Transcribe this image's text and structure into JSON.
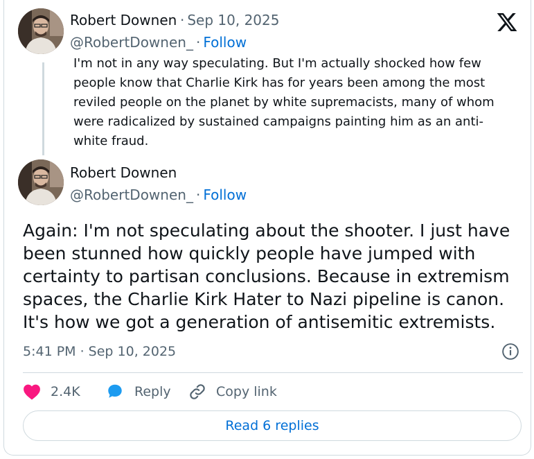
{
  "parent_tweet": {
    "author_name": "Robert Downen",
    "date": "Sep 10, 2025",
    "handle": "@RobertDownen_",
    "follow_label": "Follow",
    "text": "I'm not in any way speculating. But I'm actually shocked how few people know that Charlie Kirk has for years been among the most reviled people on the planet by white supremacists, many of whom were radicalized by sustained campaigns painting him as an anti-white fraud."
  },
  "main_tweet": {
    "author_name": "Robert Downen",
    "handle": "@RobertDownen_",
    "follow_label": "Follow",
    "text": "Again: I'm not speculating about the shooter. I just have been stunned how quickly people have jumped with certainty to partisan conclusions. Because in extremism spaces, the Charlie Kirk Hater to Nazi pipeline is canon. It's how we got a generation of antisemitic extremists.",
    "timestamp": "5:41 PM · Sep 10, 2025"
  },
  "actions": {
    "likes_count": "2.4K",
    "reply_label": "Reply",
    "copy_link_label": "Copy link"
  },
  "read_replies_label": "Read 6 replies",
  "colors": {
    "link_blue": "#006fd6",
    "like_pink": "#f91880",
    "reply_blue": "#1d9bf0",
    "secondary_text": "#536471",
    "border": "#cfd9de"
  },
  "icons": {
    "brand": "x-logo-icon",
    "info": "info-icon",
    "like": "heart-icon",
    "reply": "speech-bubble-icon",
    "copy": "link-icon"
  }
}
